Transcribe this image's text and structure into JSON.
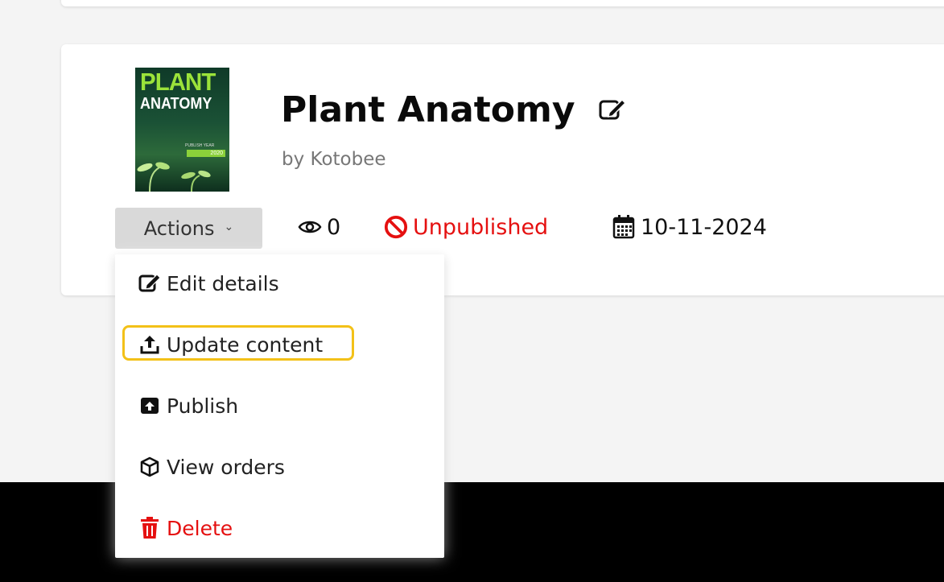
{
  "book": {
    "title": "Plant Anatomy",
    "author": "by Kotobee",
    "cover": {
      "line1": "PLANT",
      "line2": "ANATOMY",
      "publish_label": "PUBLISH YEAR",
      "year": "2020"
    }
  },
  "actions": {
    "label": "Actions"
  },
  "meta": {
    "views": "0",
    "status": "Unpublished",
    "date": "10-11-2024"
  },
  "menu": {
    "items": [
      {
        "label": "Edit details",
        "icon": "edit-icon"
      },
      {
        "label": "Update content",
        "icon": "upload-icon"
      },
      {
        "label": "Publish",
        "icon": "publish-icon"
      },
      {
        "label": "View orders",
        "icon": "box-icon"
      },
      {
        "label": "Delete",
        "icon": "trash-icon"
      }
    ]
  },
  "colors": {
    "danger": "#e51010",
    "highlight": "#f3c118",
    "button_bg": "#d9d9d9"
  }
}
